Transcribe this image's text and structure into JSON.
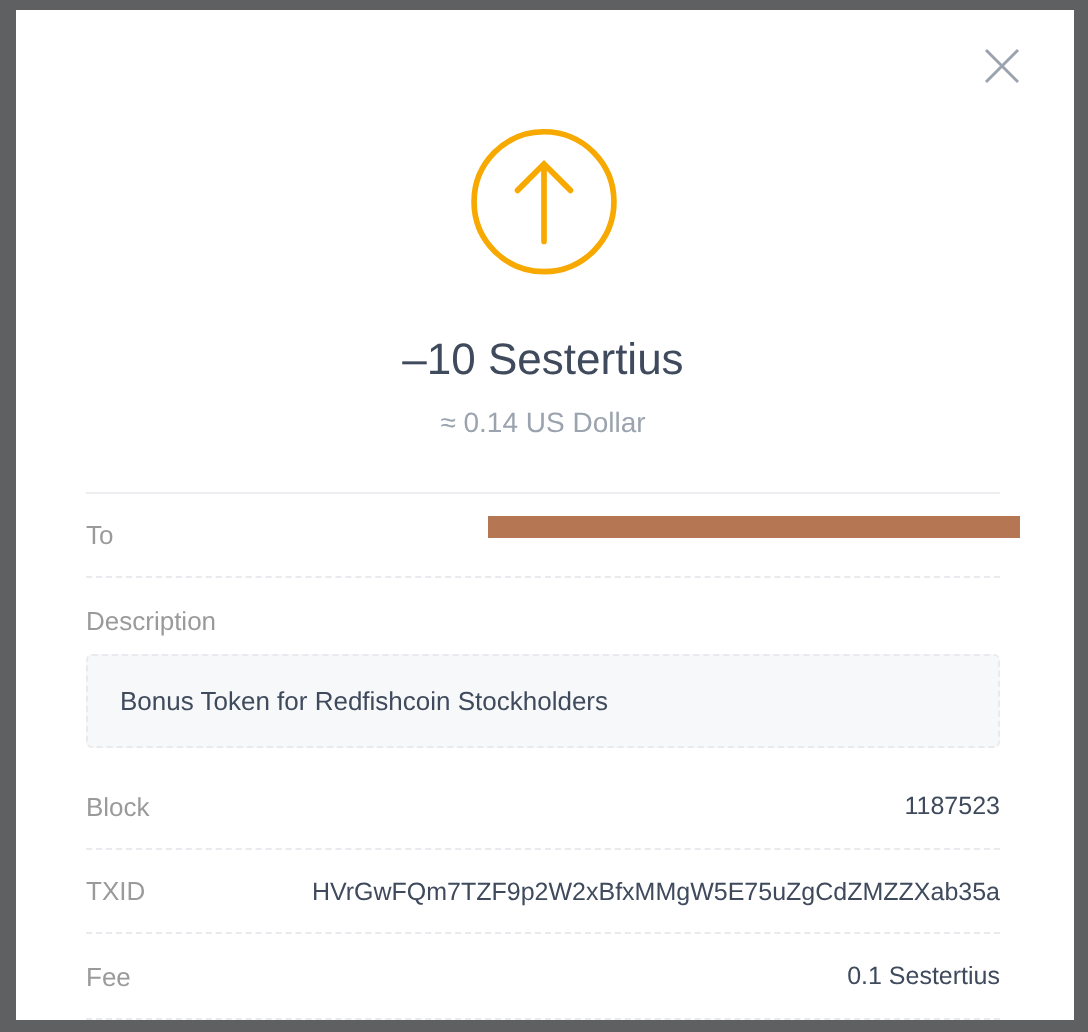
{
  "transaction": {
    "outgoing": true,
    "amount": "–10 Sestertius",
    "fiat": "≈ 0.14 US Dollar"
  },
  "details": [
    {
      "kind": "redacted",
      "label": "To"
    },
    {
      "kind": "box",
      "label": "Description",
      "value": "Bonus Token for Redfishcoin Stockholders"
    },
    {
      "kind": "row",
      "label": "Block",
      "value": "1187523"
    },
    {
      "kind": "row",
      "label": "TXID",
      "value": "HVrGwFQm7TZF9p2W2xBfxMMgW5E75uZgCdZMZZXab35a"
    },
    {
      "kind": "row",
      "label": "Fee",
      "value": "0.1 Sestertius"
    }
  ]
}
